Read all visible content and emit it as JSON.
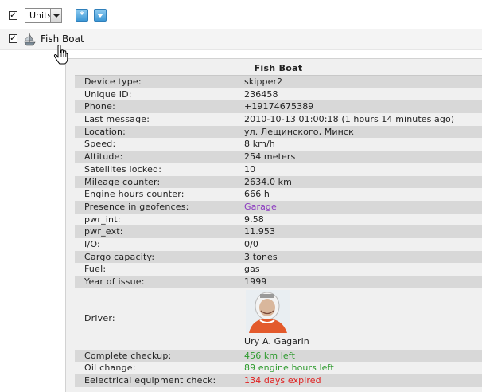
{
  "toolbar": {
    "units_select": "Units",
    "asterisk_btn": "*"
  },
  "unit": {
    "name": "Fish Boat"
  },
  "tooltip": {
    "title": "Fish Boat",
    "rows": [
      {
        "label": "Device type:",
        "value": "skipper2"
      },
      {
        "label": "Unique ID:",
        "value": "236458"
      },
      {
        "label": "Phone:",
        "value": "+19174675389"
      },
      {
        "label": "Last message:",
        "value": "2010-10-13 01:00:18 (1 hours 14 minutes ago)"
      },
      {
        "label": "Location:",
        "value": "ул. Лещинского, Минск"
      },
      {
        "label": "Speed:",
        "value": "8 km/h"
      },
      {
        "label": "Altitude:",
        "value": "254 meters"
      },
      {
        "label": "Satellites locked:",
        "value": "10"
      },
      {
        "label": "Mileage counter:",
        "value": "2634.0 km"
      },
      {
        "label": "Engine hours counter:",
        "value": "666 h"
      },
      {
        "label": "Presence in geofences:",
        "value": "Garage"
      },
      {
        "label": "pwr_int:",
        "value": "9.58"
      },
      {
        "label": "pwr_ext:",
        "value": "11.953"
      },
      {
        "label": "I/O:",
        "value": "0/0"
      },
      {
        "label": "Cargo capacity:",
        "value": "3 tones"
      },
      {
        "label": "Fuel:",
        "value": "gas"
      },
      {
        "label": "Year of issue:",
        "value": "1999"
      }
    ],
    "driver": {
      "label": "Driver:",
      "name": "Ury A. Gagarin"
    },
    "service": [
      {
        "label": "Complete checkup:",
        "value": "456 km left"
      },
      {
        "label": "Oil change:",
        "value": "89 engine hours left"
      },
      {
        "label": "Eelectrical equipment check:",
        "value": "134 days expired"
      }
    ]
  },
  "colors": {
    "geofence_link": "#8b3ac0",
    "ok": "#2d9a2d",
    "expired": "#e02020",
    "button_blue": "#3d98d6"
  }
}
